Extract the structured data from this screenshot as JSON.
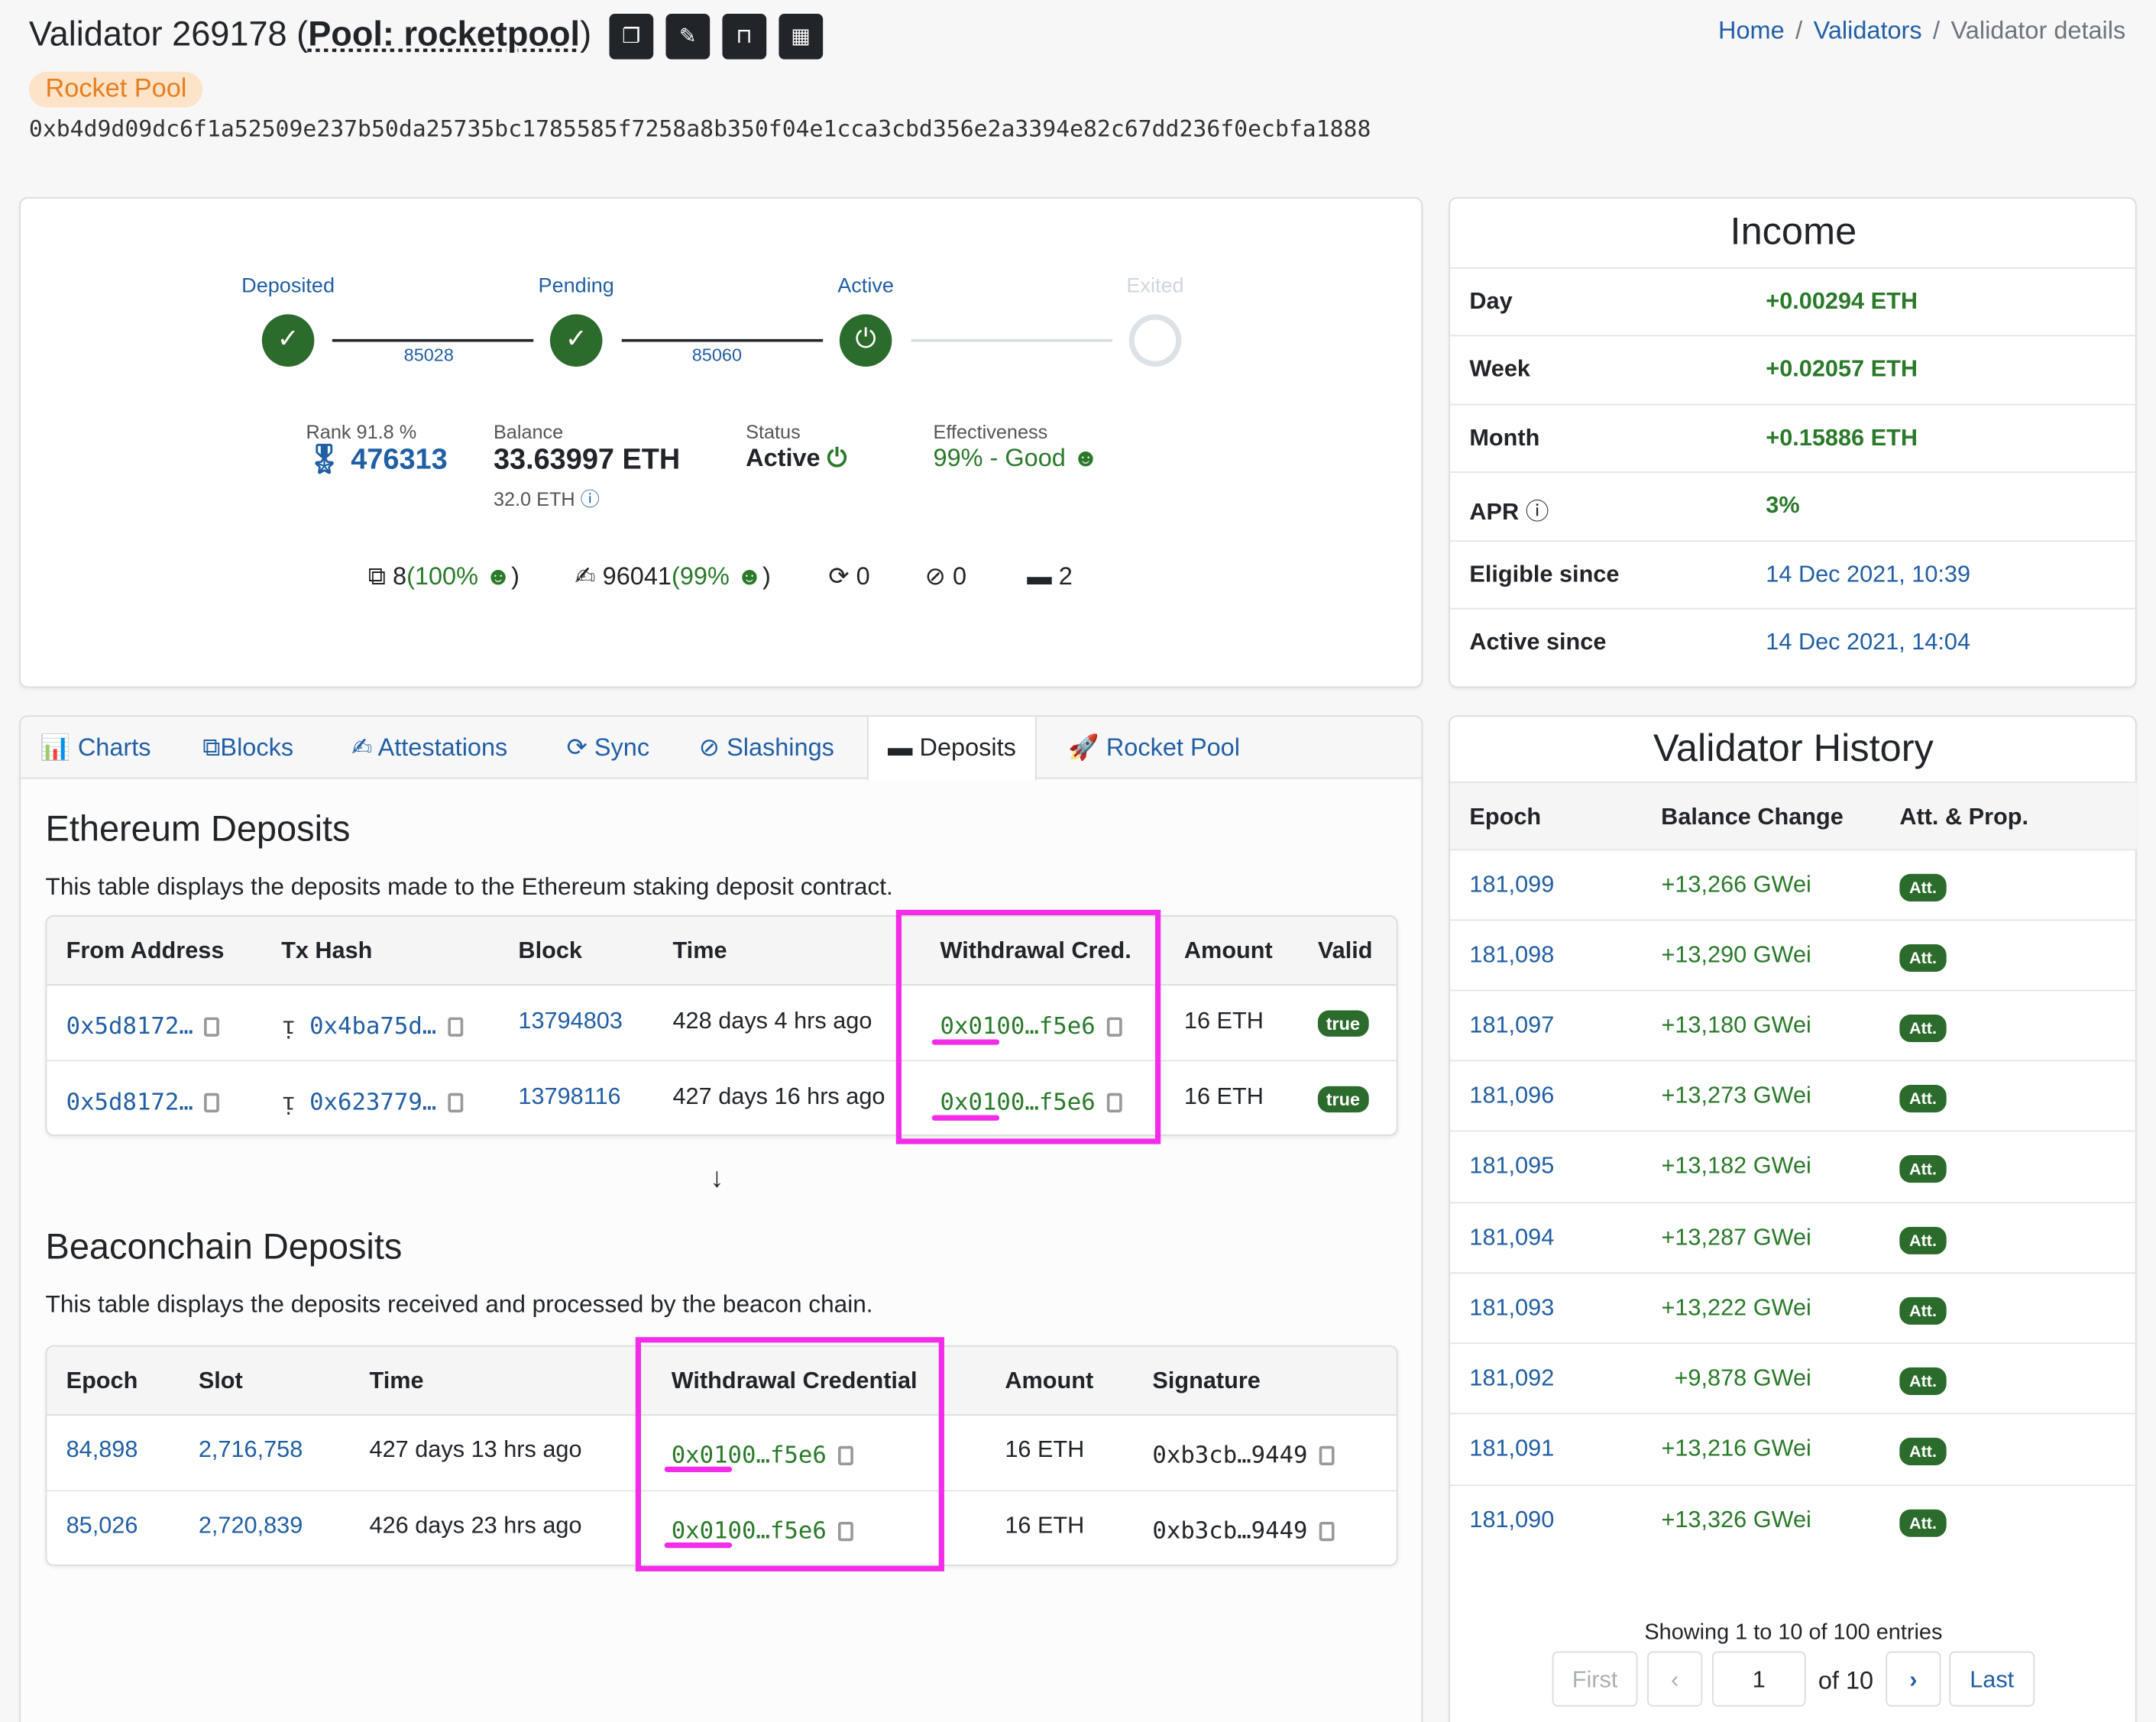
{
  "header": {
    "title_prefix": "Validator 269178 (",
    "pool_link": "Pool: rocketpool",
    "title_suffix": ")",
    "badge": "Rocket Pool",
    "pubkey": "0xb4d9d09dc6f1a52509e237b50da25735bc1785585f7258a8b350f04e1cca3cbd356e2a3394e82c67dd236f0ecbfa1888",
    "breadcrumb": [
      "Home",
      "Validators",
      "Validator details"
    ],
    "separator": "/"
  },
  "lifecycle": {
    "steps": [
      "Deposited",
      "Pending",
      "Active",
      "Exited"
    ],
    "epochs": [
      "85028",
      "85060"
    ]
  },
  "stats": {
    "rank_label": "Rank 91.8 %",
    "rank_value": "476313",
    "balance_label": "Balance",
    "balance_value": "33.63997 ETH",
    "effective_balance": "32.0 ETH",
    "status_label": "Status",
    "status_value": "Active",
    "effectiveness_label": "Effectiveness",
    "effectiveness_value": "99% - Good"
  },
  "counters": {
    "proposals": "8",
    "proposals_pct": "(100%",
    "proposals_close": ")",
    "attestations": "96041",
    "attestations_pct": "(99%",
    "attestations_close": ")",
    "sync": "0",
    "slashings": "0",
    "deposits": "2"
  },
  "income": {
    "title": "Income",
    "rows": [
      {
        "label": "Day",
        "value": "+0.00294 ETH"
      },
      {
        "label": "Week",
        "value": "+0.02057 ETH"
      },
      {
        "label": "Month",
        "value": "+0.15886 ETH"
      },
      {
        "label": "APR",
        "value": "3%"
      },
      {
        "label": "Eligible since",
        "value": "14 Dec 2021, 10:39"
      },
      {
        "label": "Active since",
        "value": "14 Dec 2021, 14:04"
      }
    ]
  },
  "tabs": [
    "Charts",
    "Blocks",
    "Attestations",
    "Sync",
    "Slashings",
    "Deposits",
    "Rocket Pool"
  ],
  "eth_deposits": {
    "title": "Ethereum Deposits",
    "description": "This table displays the deposits made to the Ethereum staking deposit contract.",
    "columns": [
      "From Address",
      "Tx Hash",
      "Block",
      "Time",
      "Withdrawal Cred.",
      "Amount",
      "Valid"
    ],
    "rows": [
      {
        "from": "0x5d8172…",
        "tx": "0x4ba75d…",
        "block": "13794803",
        "time": "428 days 4 hrs ago",
        "cred": "0x0100…f5e6",
        "amount": "16 ETH",
        "valid": "true"
      },
      {
        "from": "0x5d8172…",
        "tx": "0x623779…",
        "block": "13798116",
        "time": "427 days 16 hrs ago",
        "cred": "0x0100…f5e6",
        "amount": "16 ETH",
        "valid": "true"
      }
    ]
  },
  "arrow": "↓",
  "beacon_deposits": {
    "title": "Beaconchain Deposits",
    "description": "This table displays the deposits received and processed by the beacon chain.",
    "columns": [
      "Epoch",
      "Slot",
      "Time",
      "Withdrawal Credential",
      "Amount",
      "Signature"
    ],
    "rows": [
      {
        "epoch": "84,898",
        "slot": "2,716,758",
        "time": "427 days 13 hrs ago",
        "cred": "0x0100…f5e6",
        "amount": "16 ETH",
        "sig": "0xb3cb…9449"
      },
      {
        "epoch": "85,026",
        "slot": "2,720,839",
        "time": "426 days 23 hrs ago",
        "cred": "0x0100…f5e6",
        "amount": "16 ETH",
        "sig": "0xb3cb…9449"
      }
    ]
  },
  "history": {
    "title": "Validator History",
    "columns": [
      "Epoch",
      "Balance Change",
      "Att. & Prop."
    ],
    "att_label": "Att.",
    "rows": [
      {
        "epoch": "181,099",
        "change": "+13,266 GWei"
      },
      {
        "epoch": "181,098",
        "change": "+13,290 GWei"
      },
      {
        "epoch": "181,097",
        "change": "+13,180 GWei"
      },
      {
        "epoch": "181,096",
        "change": "+13,273 GWei"
      },
      {
        "epoch": "181,095",
        "change": "+13,182 GWei"
      },
      {
        "epoch": "181,094",
        "change": "+13,287 GWei"
      },
      {
        "epoch": "181,093",
        "change": "+13,222 GWei"
      },
      {
        "epoch": "181,092",
        "change": "+9,878 GWei"
      },
      {
        "epoch": "181,091",
        "change": "+13,216 GWei"
      },
      {
        "epoch": "181,090",
        "change": "+13,326 GWei"
      }
    ],
    "showing": "Showing 1 to 10 of 100 entries",
    "first": "First",
    "last": "Last",
    "page": "1",
    "of_pages": "of 10"
  },
  "colors": {
    "highlight": "#f22ce8",
    "link": "#215fa4",
    "success": "#2b6b2b",
    "badge": "#fde3c7"
  }
}
